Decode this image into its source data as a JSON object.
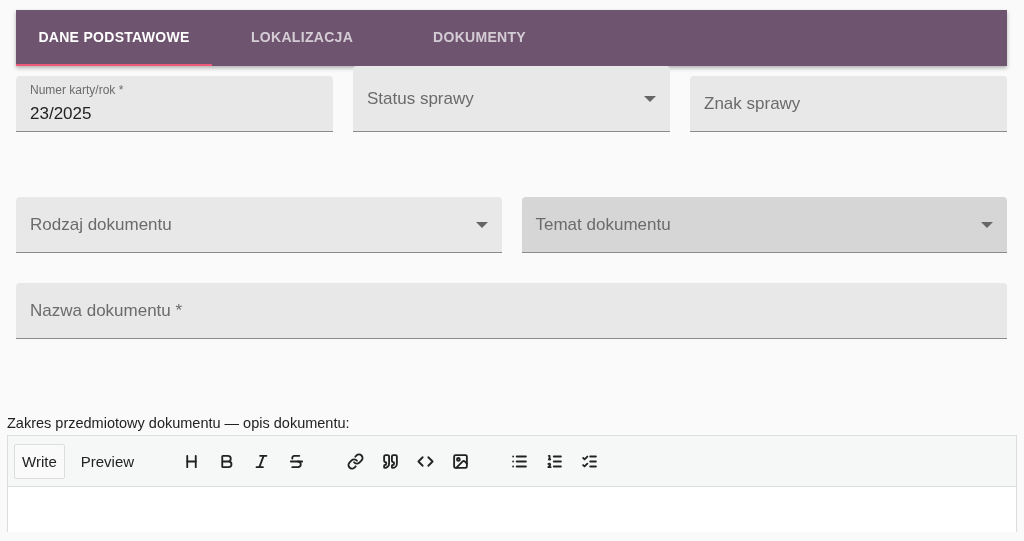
{
  "tabs": [
    {
      "label": "DANE PODSTAWOWE",
      "selected": true
    },
    {
      "label": "LOKALIZACJA",
      "selected": false
    },
    {
      "label": "DOKUMENTY",
      "selected": false
    }
  ],
  "field_rows": [
    [
      {
        "kind": "text",
        "label": "Numer karty/rok *",
        "value": "23/2025",
        "disabled": false
      },
      {
        "kind": "select",
        "label": "Status sprawy",
        "disabled": false
      },
      {
        "kind": "text",
        "label": "Znak sprawy",
        "disabled": false
      }
    ],
    [
      {
        "kind": "select",
        "label": "Rodzaj dokumentu",
        "disabled": false
      },
      {
        "kind": "select",
        "label": "Temat dokumentu",
        "disabled": true
      }
    ],
    [
      {
        "kind": "text",
        "label": "Nazwa dokumentu *",
        "disabled": false
      }
    ]
  ],
  "editor": {
    "label": "Zakres przedmiotowy dokumentu — opis dokumentu:",
    "modes": [
      {
        "label": "Write",
        "selected": true
      },
      {
        "label": "Preview",
        "selected": false
      }
    ],
    "tools": [
      {
        "kind": "heading"
      },
      {
        "kind": "bold"
      },
      {
        "kind": "italic"
      },
      {
        "kind": "strike"
      },
      {
        "kind": "sep"
      },
      {
        "kind": "link"
      },
      {
        "kind": "quote"
      },
      {
        "kind": "code"
      },
      {
        "kind": "image"
      },
      {
        "kind": "sep"
      },
      {
        "kind": "bullets"
      },
      {
        "kind": "numbered"
      },
      {
        "kind": "tasks"
      }
    ]
  }
}
